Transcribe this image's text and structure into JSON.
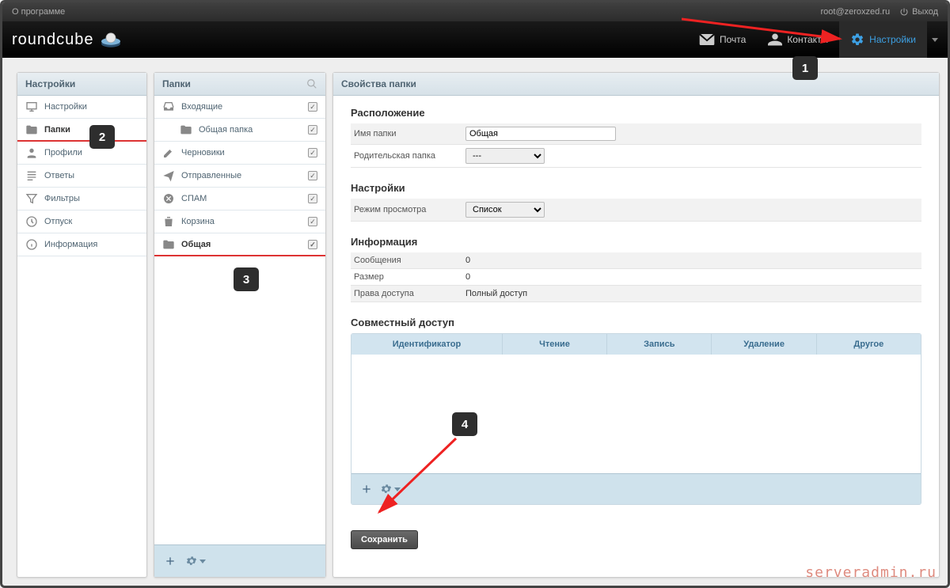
{
  "topbar": {
    "about": "О программе",
    "user": "root@zeroxzed.ru",
    "logout": "Выход"
  },
  "logo": "roundcube",
  "nav": {
    "mail": "Почта",
    "contacts": "Контакты",
    "settings": "Настройки"
  },
  "settings_panel": {
    "title": "Настройки",
    "items": [
      "Настройки",
      "Папки",
      "Профили",
      "Ответы",
      "Фильтры",
      "Отпуск",
      "Информация"
    ]
  },
  "folders_panel": {
    "title": "Папки",
    "items": [
      "Входящие",
      "Общая папка",
      "Черновики",
      "Отправленные",
      "СПАМ",
      "Корзина",
      "Общая"
    ]
  },
  "props_panel": {
    "title": "Свойства папки",
    "location": {
      "legend": "Расположение",
      "name_label": "Имя папки",
      "name_value": "Общая",
      "parent_label": "Родительская папка",
      "parent_value": "---"
    },
    "settings": {
      "legend": "Настройки",
      "mode_label": "Режим просмотра",
      "mode_value": "Список"
    },
    "info": {
      "legend": "Информация",
      "messages_label": "Сообщения",
      "messages_value": "0",
      "size_label": "Размер",
      "size_value": "0",
      "rights_label": "Права доступа",
      "rights_value": "Полный доступ"
    },
    "share": {
      "legend": "Совместный доступ",
      "cols": [
        "Идентификатор",
        "Чтение",
        "Запись",
        "Удаление",
        "Другое"
      ]
    },
    "save": "Сохранить"
  },
  "annotations": [
    "1",
    "2",
    "3",
    "4"
  ],
  "watermark": "serveradmin.ru"
}
